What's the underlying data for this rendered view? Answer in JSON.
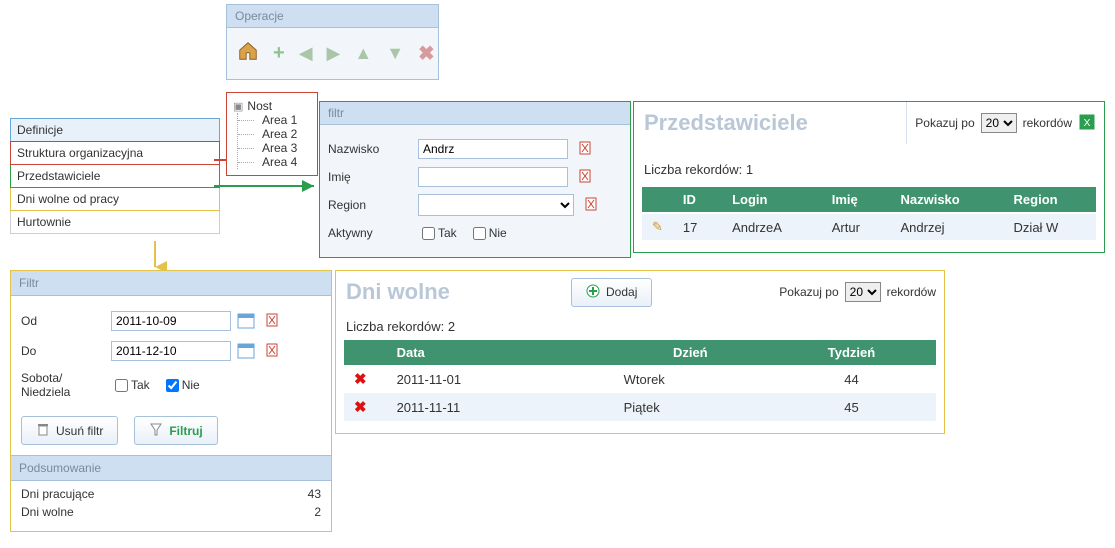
{
  "definicje": {
    "title": "Definicje",
    "items": [
      {
        "label": "Struktura organizacyjna",
        "color": "red"
      },
      {
        "label": "Przedstawiciele",
        "color": "green"
      },
      {
        "label": "Dni wolne od pracy",
        "color": "yellow"
      },
      {
        "label": "Hurtownie",
        "color": "plain"
      }
    ]
  },
  "operacje": {
    "title": "Operacje"
  },
  "tree": {
    "root": "Nost",
    "children": [
      "Area 1",
      "Area 2",
      "Area 3",
      "Area 4"
    ]
  },
  "filtr": {
    "title": "filtr",
    "fields": {
      "nazwisko_label": "Nazwisko",
      "nazwisko_value": "Andrz",
      "imie_label": "Imię",
      "imie_value": "",
      "region_label": "Region",
      "region_value": "",
      "aktywny_label": "Aktywny",
      "tak": "Tak",
      "nie": "Nie"
    }
  },
  "reps": {
    "title": "Przedstawiciele",
    "pager_prefix": "Pokazuj po",
    "pager_value": "20",
    "pager_suffix": "rekordów",
    "count_prefix": "Liczba rekordów:",
    "count": "1",
    "cols": [
      "ID",
      "Login",
      "Imię",
      "Nazwisko",
      "Region"
    ],
    "rows": [
      {
        "id": "17",
        "login": "AndrzeA",
        "imie": "Artur",
        "nazwisko": "Andrzej",
        "region": "Dział W"
      }
    ]
  },
  "dni": {
    "title": "Dni wolne",
    "add": "Dodaj",
    "pager_prefix": "Pokazuj po",
    "pager_value": "20",
    "pager_suffix": "rekordów",
    "count_prefix": "Liczba rekordów:",
    "count": "2",
    "cols": [
      "Data",
      "Dzień",
      "Tydzień"
    ],
    "rows": [
      {
        "data": "2011-11-01",
        "dzien": "Wtorek",
        "tydz": "44"
      },
      {
        "data": "2011-11-11",
        "dzien": "Piątek",
        "tydz": "45"
      }
    ]
  },
  "yfilt": {
    "title": "Filtr",
    "od_label": "Od",
    "od_value": "2011-10-09",
    "do_label": "Do",
    "do_value": "2011-12-10",
    "sn_label": "Sobota/ Niedziela",
    "tak": "Tak",
    "nie": "Nie",
    "clear": "Usuń filtr",
    "apply": "Filtruj",
    "summary_title": "Podsumowanie",
    "sum1_label": "Dni pracujące",
    "sum1_val": "43",
    "sum2_label": "Dni wolne",
    "sum2_val": "2"
  }
}
